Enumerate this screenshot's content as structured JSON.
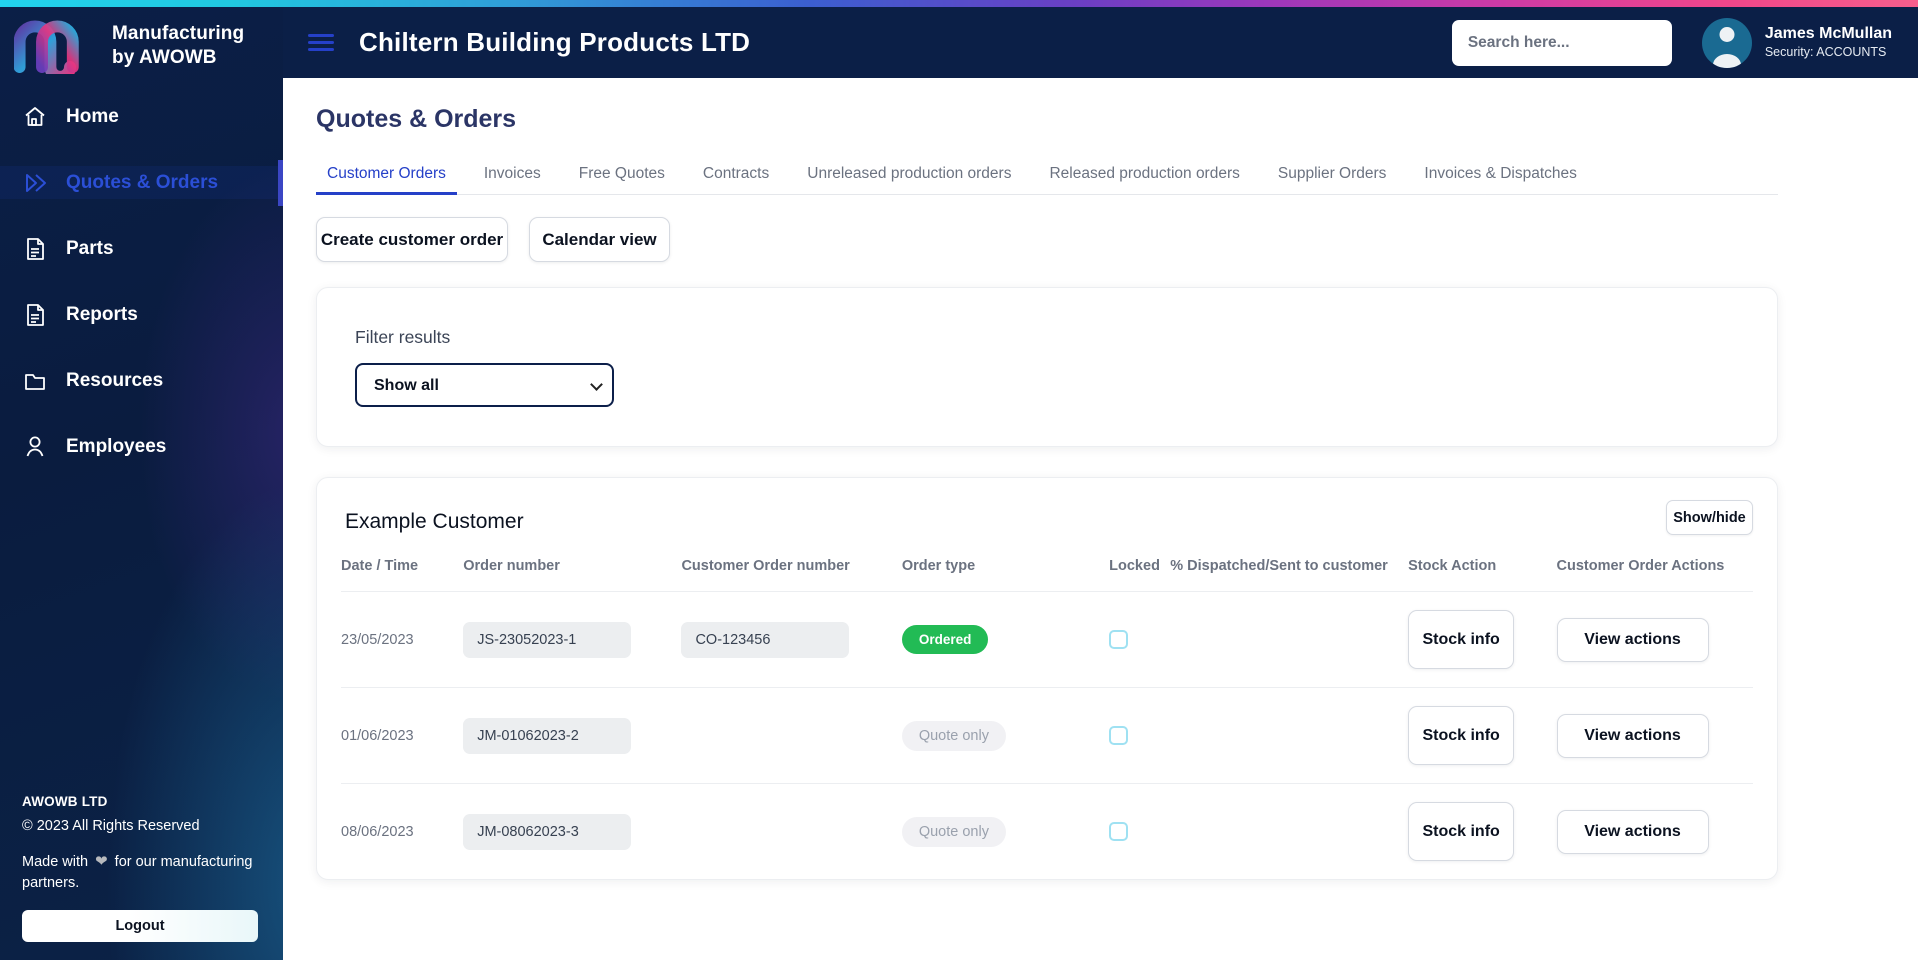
{
  "brand": {
    "line1": "Manufacturing",
    "line2": "by AWOWB",
    "logo_icon": "awowb-m-logo"
  },
  "sidebar": {
    "items": [
      {
        "label": "Home",
        "icon": "home-icon",
        "active": false
      },
      {
        "label": "Quotes & Orders",
        "icon": "double-chevron-right-icon",
        "active": true
      },
      {
        "label": "Parts",
        "icon": "document-icon",
        "active": false
      },
      {
        "label": "Reports",
        "icon": "document-icon",
        "active": false
      },
      {
        "label": "Resources",
        "icon": "folder-icon",
        "active": false
      },
      {
        "label": "Employees",
        "icon": "user-icon",
        "active": false
      }
    ],
    "footer": {
      "company": "AWOWB LTD",
      "copyright": "© 2023 All Rights Reserved",
      "made_with_prefix": "Made with",
      "heart_icon": "heart-icon",
      "made_with_suffix": "for our manufacturing partners.",
      "logout_label": "Logout"
    }
  },
  "header": {
    "menu_icon": "hamburger-menu-icon",
    "title": "Chiltern Building Products LTD",
    "search_placeholder": "Search here...",
    "search_value": "",
    "user": {
      "avatar_icon": "user-avatar-icon",
      "name": "James McMullan",
      "security": "Security: ACCOUNTS"
    }
  },
  "page": {
    "title": "Quotes & Orders",
    "tabs": [
      {
        "label": "Customer Orders",
        "active": true
      },
      {
        "label": "Invoices",
        "active": false
      },
      {
        "label": "Free Quotes",
        "active": false
      },
      {
        "label": "Contracts",
        "active": false
      },
      {
        "label": "Unreleased production orders",
        "active": false
      },
      {
        "label": "Released production orders",
        "active": false
      },
      {
        "label": "Supplier Orders",
        "active": false
      },
      {
        "label": "Invoices & Dispatches",
        "active": false
      }
    ],
    "actions": {
      "create_label": "Create customer order",
      "calendar_label": "Calendar view"
    },
    "filter": {
      "label": "Filter results",
      "selected": "Show all",
      "options": [
        "Show all"
      ],
      "chevron_icon": "chevron-down-icon"
    },
    "table": {
      "customer": "Example Customer",
      "showhide_label": "Show/hide",
      "columns": [
        "Date / Time",
        "Order number",
        "Customer Order number",
        "Order type",
        "Locked",
        "% Dispatched/Sent to customer",
        "Stock Action",
        "Customer Order Actions"
      ],
      "rows": [
        {
          "date": "23/05/2023",
          "order_number": "JS-23052023-1",
          "customer_order_number": "CO-123456",
          "order_type": "Ordered",
          "order_type_style": "ordered",
          "locked": false,
          "dispatched_pct": "",
          "stock_label": "Stock info",
          "action_label": "View actions"
        },
        {
          "date": "01/06/2023",
          "order_number": "JM-01062023-2",
          "customer_order_number": "",
          "order_type": "Quote only",
          "order_type_style": "quote",
          "locked": false,
          "dispatched_pct": "",
          "stock_label": "Stock info",
          "action_label": "View actions"
        },
        {
          "date": "08/06/2023",
          "order_number": "JM-08062023-3",
          "customer_order_number": "",
          "order_type": "Quote only",
          "order_type_style": "quote",
          "locked": false,
          "dispatched_pct": "",
          "stock_label": "Stock info",
          "action_label": "View actions"
        }
      ]
    }
  },
  "colors": {
    "sidebar_bg": "#0b1f47",
    "accent_blue": "#2540c8",
    "badge_green": "#22bb55",
    "badge_grey": "#f1f1f4",
    "checkbox_border": "#9fe1f2",
    "title_navy": "#2b3566"
  }
}
